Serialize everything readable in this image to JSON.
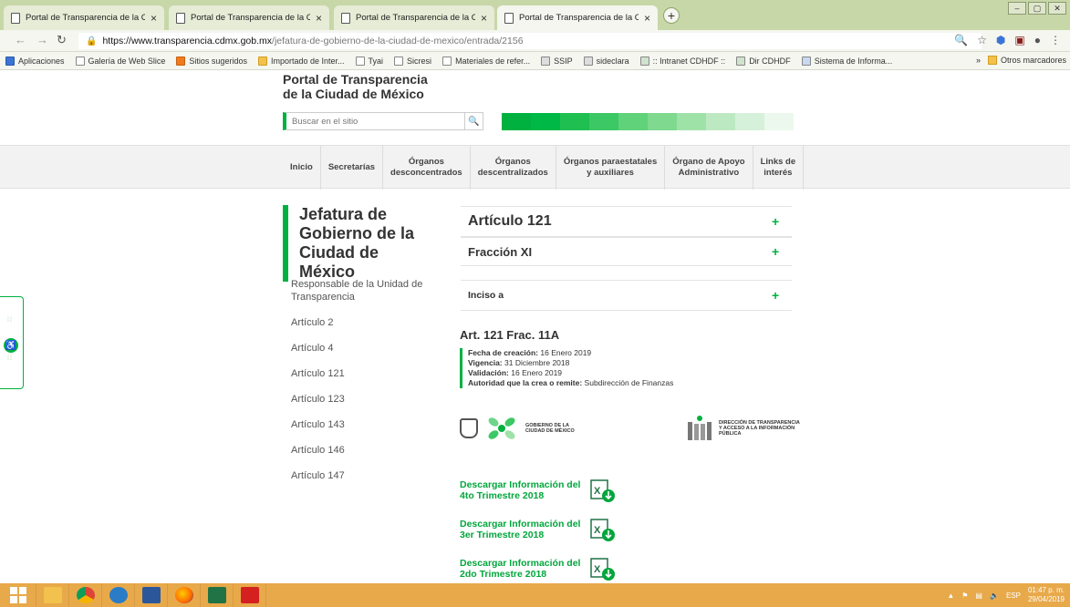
{
  "browser": {
    "tabs": [
      {
        "title": "Portal de Transparencia de la CDM"
      },
      {
        "title": "Portal de Transparencia de la CDM"
      },
      {
        "title": "Portal de Transparencia de la CDM"
      },
      {
        "title": "Portal de Transparencia de la CDM"
      }
    ],
    "close_symbol": "×",
    "new_tab_symbol": "+",
    "window_buttons": [
      "‒",
      "▢",
      "✕"
    ],
    "url_host": "https://www.transparencia.cdmx.gob.mx",
    "url_path": "/jefatura-de-gobierno-de-la-ciudad-de-mexico/entrada/2156",
    "bookmarks": [
      {
        "label": "Aplicaciones",
        "icon": "apps-icon"
      },
      {
        "label": "Galería de Web Slice",
        "icon": "page-icon"
      },
      {
        "label": "Sitios sugeridos",
        "icon": "orange-icon"
      },
      {
        "label": "Importado de Inter...",
        "icon": "folder-icon"
      },
      {
        "label": "Tyai",
        "icon": "page-icon"
      },
      {
        "label": "Sicresi",
        "icon": "page-icon"
      },
      {
        "label": "Materiales de refer...",
        "icon": "page-icon"
      },
      {
        "label": "SSIP",
        "icon": "image-icon"
      },
      {
        "label": "sideclara",
        "icon": "image-icon"
      },
      {
        "label": ":: Intranet CDHDF ::",
        "icon": "grid-icon"
      },
      {
        "label": "Dir CDHDF",
        "icon": "grid-icon"
      },
      {
        "label": "Sistema de Informa...",
        "icon": "shuffle-icon"
      }
    ],
    "bookmarks_more": "»",
    "other_bookmarks": "Otros marcadores"
  },
  "site": {
    "title_line1": "Portal de Transparencia",
    "title_line2": "de la Ciudad de México",
    "search_placeholder": "Buscar en el sitio",
    "gradient_colors": [
      "#00b140",
      "#00b846",
      "#1fbf52",
      "#3cc864",
      "#5fd27a",
      "#7fd98f",
      "#9fe2a8",
      "#bde9c2",
      "#d6f1d9",
      "#ecf8ed"
    ],
    "menu": [
      {
        "line1": "Inicio",
        "line2": ""
      },
      {
        "line1": "Secretarías",
        "line2": ""
      },
      {
        "line1": "Órganos",
        "line2": "desconcentrados"
      },
      {
        "line1": "Órganos",
        "line2": "descentralizados"
      },
      {
        "line1": "Órganos paraestatales",
        "line2": "y auxiliares"
      },
      {
        "line1": "Órgano de Apoyo",
        "line2": "Administrativo"
      },
      {
        "line1": "Links de",
        "line2": "interés"
      }
    ]
  },
  "sidebar": {
    "title": "Jefatura de Gobierno de la Ciudad de México",
    "links": [
      "Responsable de la Unidad de Transparencia",
      "Artículo 2",
      "Artículo 4",
      "Artículo 121",
      "Artículo 123",
      "Artículo 143",
      "Artículo 146",
      "Artículo 147"
    ]
  },
  "content": {
    "accordion": [
      {
        "label": "Artículo 121",
        "sign": "+"
      },
      {
        "label": "Fracción XI",
        "sign": "+"
      },
      {
        "label": "Inciso a",
        "sign": "+"
      }
    ],
    "article_title": "Art. 121 Frac. 11A",
    "meta": [
      {
        "label": "Fecha de creación:",
        "value": "16 Enero 2019"
      },
      {
        "label": "Vigencia:",
        "value": "31 Diciembre 2018"
      },
      {
        "label": "Validación:",
        "value": "16 Enero 2019"
      },
      {
        "label": "Autoridad que la crea o remite:",
        "value": "Subdirección de Finanzas"
      }
    ],
    "logo_left_text_1": "GOBIERNO DE LA",
    "logo_left_text_2": "CIUDAD DE MÉXICO",
    "logo_right_text_1": "DIRECCIÓN DE TRANSPARENCIA",
    "logo_right_text_2": "Y ACCESO A LA INFORMACIÓN",
    "logo_right_text_3": "PÚBLICA",
    "downloads": [
      {
        "line1": "Descargar Información del",
        "line2": "4to Trimestre 2018"
      },
      {
        "line1": "Descargar Información del",
        "line2": "3er Trimestre 2018"
      },
      {
        "line1": "Descargar Información del",
        "line2": "2do Trimestre 2018"
      }
    ]
  },
  "taskbar": {
    "language": "ESP",
    "time": "01:47 p. m.",
    "date": "29/04/2019",
    "tray_arrow": "▲"
  },
  "colors": {
    "accent": "#00b140",
    "taskbar": "#e8a94a",
    "chrome_frame": "#c8d7a7"
  }
}
